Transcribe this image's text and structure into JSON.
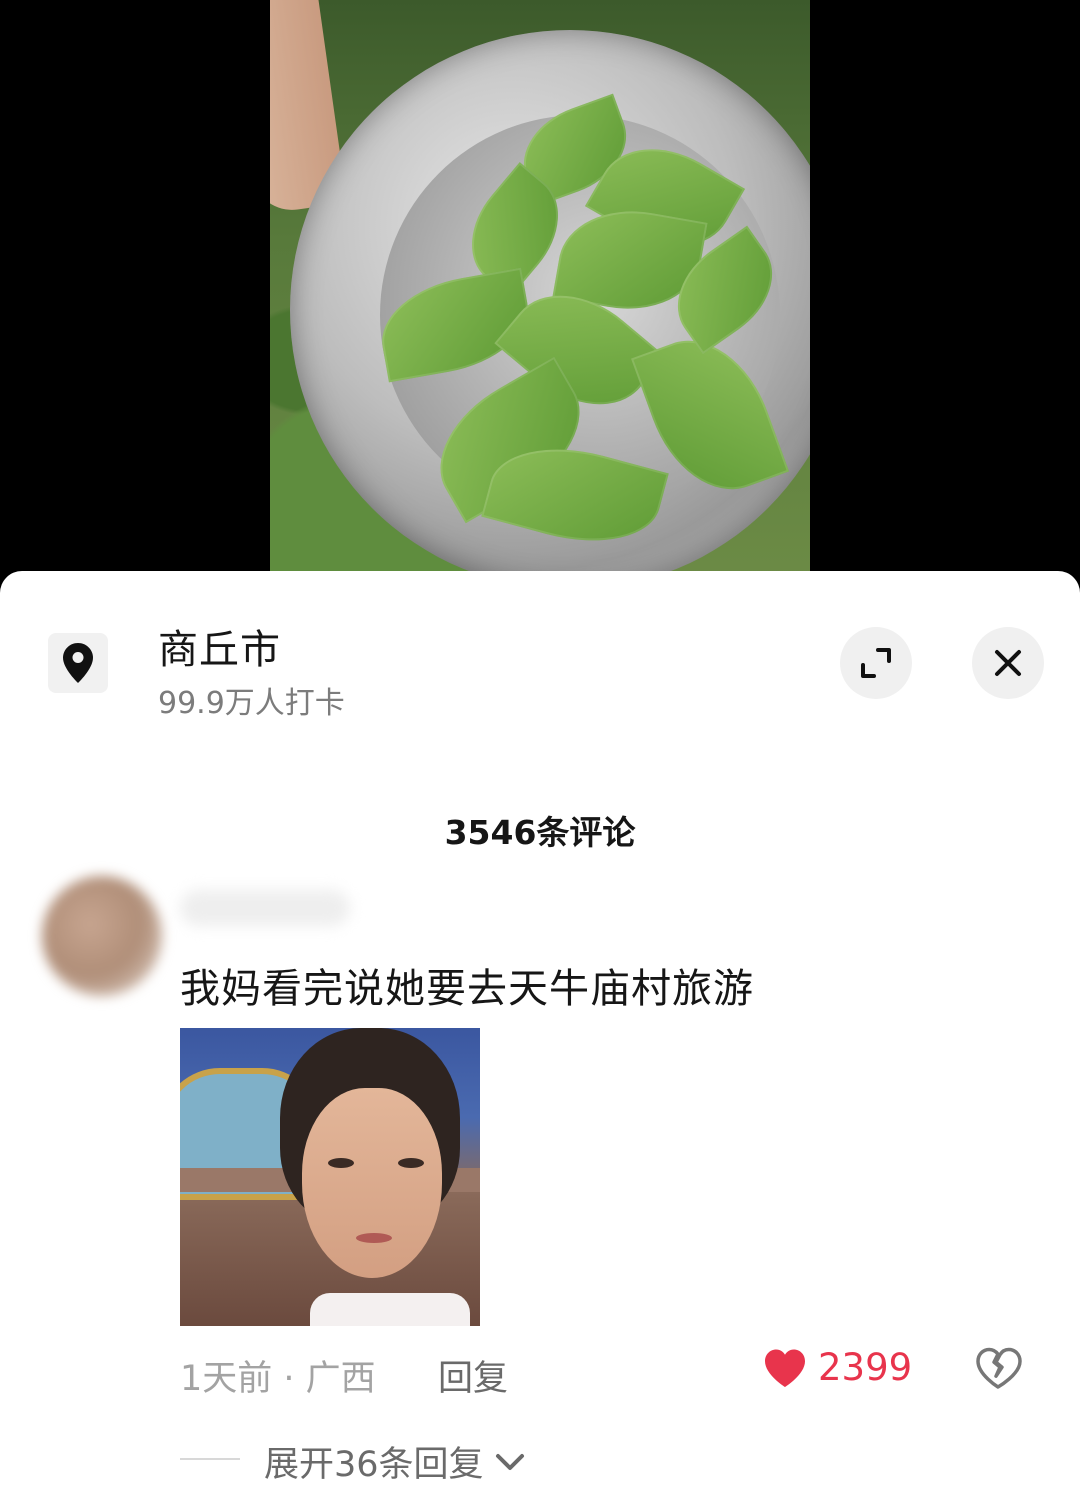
{
  "location": {
    "name": "商丘市",
    "checkins": "99.9万人打卡"
  },
  "comments": {
    "count_label": "3546条评论",
    "items": [
      {
        "text": "我妈看完说她要去天牛庙村旅游",
        "meta": "1天前 · 广西",
        "reply_label": "回复",
        "likes": "2399",
        "expand_label": "展开36条回复"
      }
    ]
  },
  "icons": {
    "location": "location-pin-icon",
    "expand": "expand-icon",
    "close": "close-icon",
    "like": "heart-icon",
    "dislike": "broken-heart-icon",
    "chevron": "chevron-down-icon"
  },
  "colors": {
    "like": "#e8344c",
    "text": "#161616",
    "muted": "#a3a3a3"
  }
}
